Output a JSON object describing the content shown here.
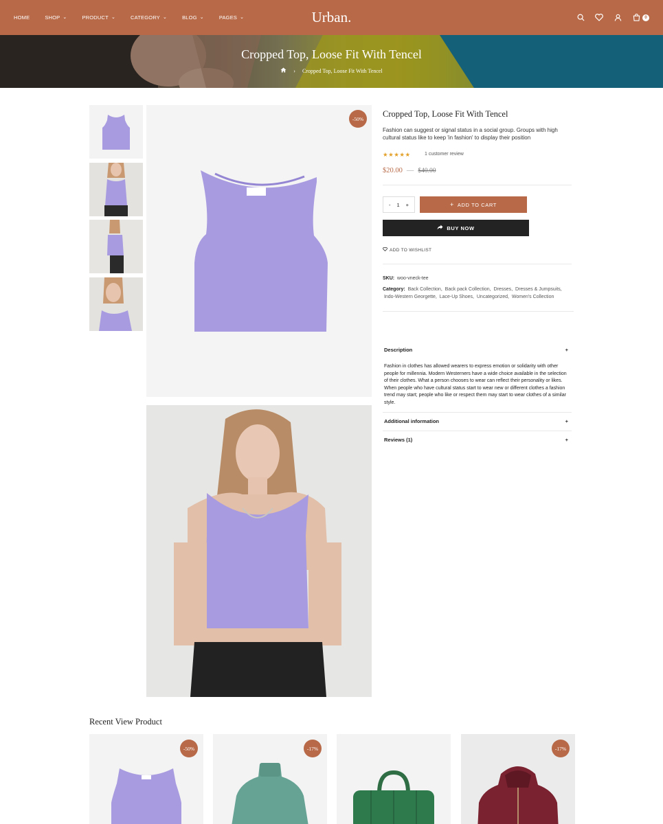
{
  "header": {
    "nav": [
      {
        "label": "HOME",
        "dropdown": false
      },
      {
        "label": "SHOP",
        "dropdown": true
      },
      {
        "label": "PRODUCT",
        "dropdown": true
      },
      {
        "label": "CATEGORY",
        "dropdown": true
      },
      {
        "label": "BLOG",
        "dropdown": true
      },
      {
        "label": "PAGES",
        "dropdown": true
      }
    ],
    "logo": "Urban.",
    "cart_count": "0",
    "icons": [
      "search-icon",
      "heart-icon",
      "user-icon",
      "cart-icon"
    ]
  },
  "banner": {
    "title": "Cropped Top, Loose Fit With Tencel",
    "breadcrumb_current": "Cropped Top, Loose Fit With Tencel"
  },
  "gallery": {
    "main_badge": "-50%"
  },
  "product": {
    "title": "Cropped Top, Loose Fit With Tencel",
    "description": "Fashion can suggest or signal status in a social group. Groups with high cultural status like to keep 'in fashion' to display their position",
    "rating": 5,
    "review_link": "1 customer review",
    "price": "$20.00",
    "price_separator": "—",
    "old_price": "$40.00",
    "quantity": "1",
    "qty_minus": "-",
    "qty_plus": "+",
    "add_to_cart": "ADD TO CART",
    "buy_now": "BUY NOW",
    "wishlist": "ADD TO WISHLIST",
    "sku_label": "SKU:",
    "sku": "woo-vneck-tee",
    "category_label": "Category:",
    "categories": [
      "Back Collection",
      "Back pack Collection",
      "Dresses",
      "Dresses & Jumpsuits",
      "Indo-Western Georgette",
      "Lace-Up Shoes",
      "Uncategorized",
      "Women's Collection"
    ]
  },
  "accordion": {
    "description_title": "Description",
    "description_text": "Fashion in clothes has allowed wearers to express emotion or solidarity with other people for millennia. Modern Westerners have a wide choice available in the selection of their clothes. What a person chooses to wear can reflect their personality or likes. When people who have cultural status start to wear new or different clothes a fashion trend may start; people who like or respect them may start to wear clothes of a similar style.",
    "additional_title": "Additional information",
    "reviews_title": "Reviews (1)",
    "toggle": "+"
  },
  "recent": {
    "title": "Recent View Product",
    "cards": [
      {
        "badge": "-50%",
        "product": "purple tank top"
      },
      {
        "badge": "-17%",
        "product": "teal turtleneck"
      },
      {
        "badge": "",
        "product": "green puffer tote bag"
      },
      {
        "badge": "-17%",
        "product": "burgundy sleeveless hoodie"
      }
    ]
  },
  "colors": {
    "accent": "#b86a48",
    "dark": "#232323",
    "star": "#e3a12a",
    "tank": "#a99be0"
  }
}
